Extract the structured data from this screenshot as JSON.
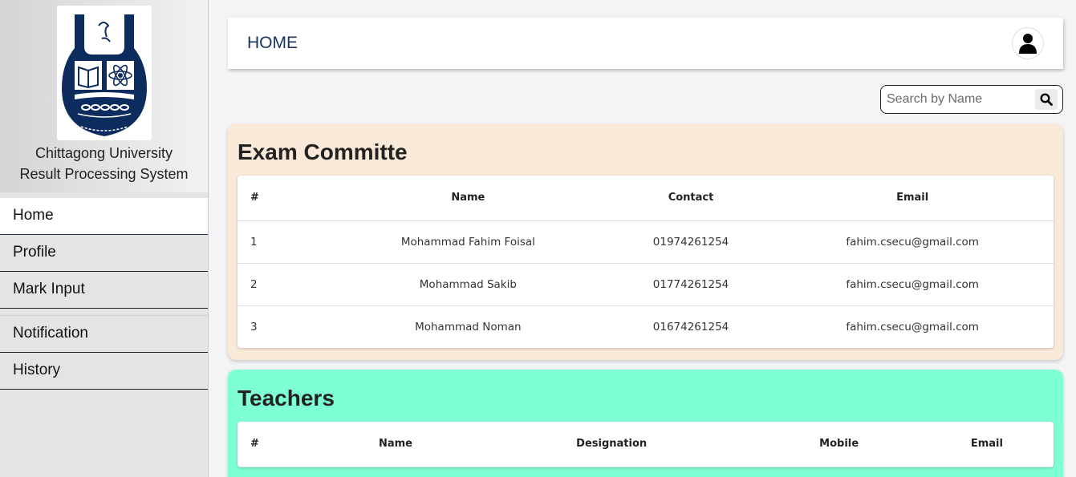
{
  "brand": {
    "line1": "Chittagong University",
    "line2": "Result Processing System"
  },
  "sidebar": {
    "items": [
      {
        "label": "Home",
        "active": true
      },
      {
        "label": "Profile"
      },
      {
        "label": "Mark Input"
      },
      {
        "label": "Notification"
      },
      {
        "label": "History"
      }
    ]
  },
  "header": {
    "title": "HOME",
    "avatar_icon": "user-icon"
  },
  "search": {
    "placeholder": "Search by Name",
    "icon": "search-icon"
  },
  "exam_committee": {
    "title": "Exam Committe",
    "columns": [
      "#",
      "Name",
      "Contact",
      "Email"
    ],
    "rows": [
      [
        "1",
        "Mohammad Fahim Foisal",
        "01974261254",
        "fahim.csecu@gmail.com"
      ],
      [
        "2",
        "Mohammad Sakib",
        "01774261254",
        "fahim.csecu@gmail.com"
      ],
      [
        "3",
        "Mohammad Noman",
        "01674261254",
        "fahim.csecu@gmail.com"
      ]
    ]
  },
  "teachers": {
    "title": "Teachers",
    "columns": [
      "#",
      "Name",
      "Designation",
      "Mobile",
      "Email"
    ]
  },
  "colors": {
    "exam_card": "#f8e9d8",
    "teachers_card": "#7fffd4",
    "header_text": "#1a3560",
    "logo_navy": "#0d2c5e"
  }
}
